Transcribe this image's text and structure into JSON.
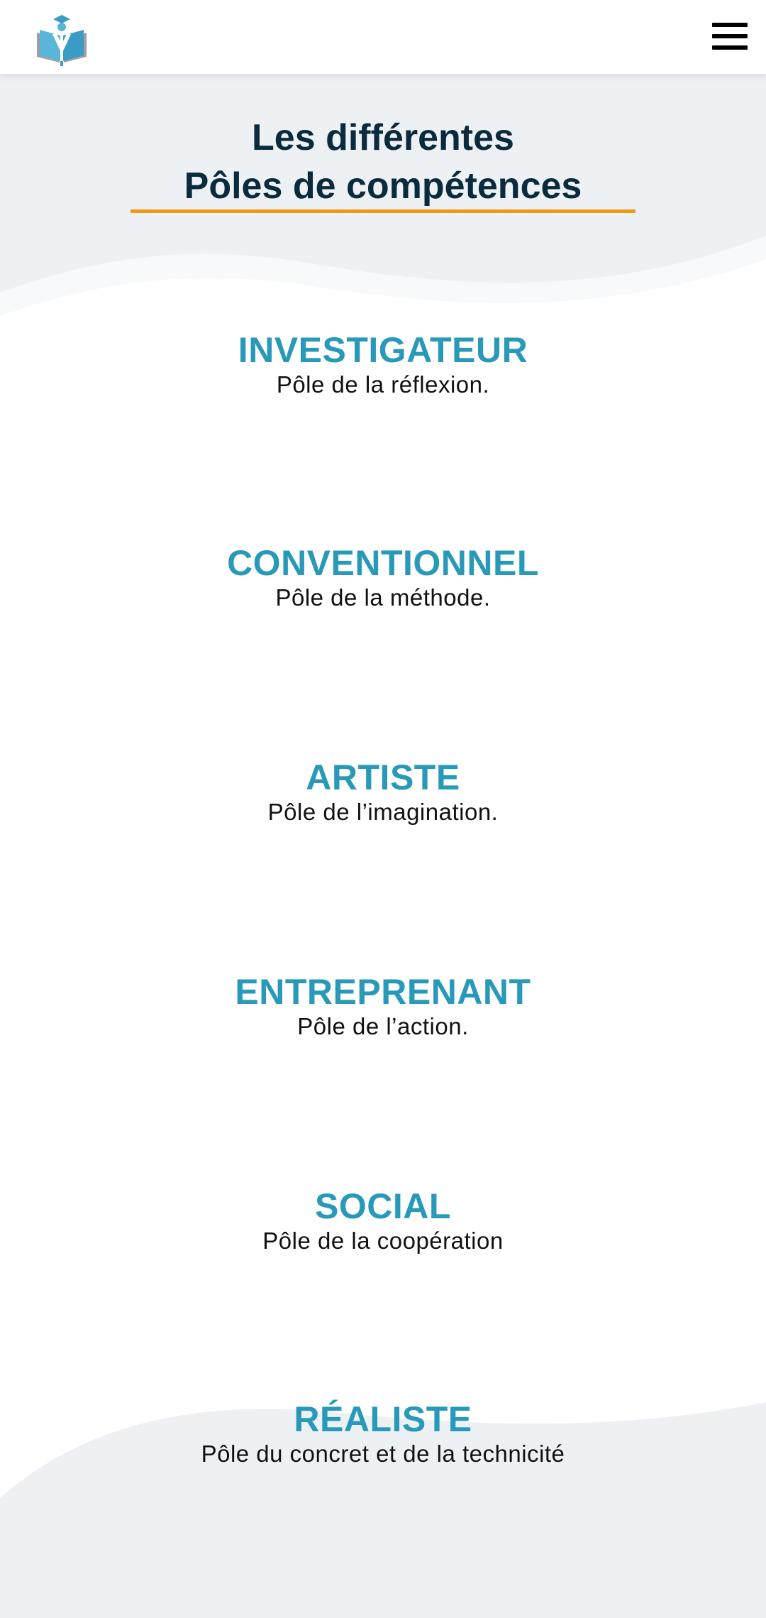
{
  "header": {
    "logo_icon": "graduate-book-logo-icon",
    "menu_icon": "hamburger-menu-icon"
  },
  "colors": {
    "title": "#0a2a3d",
    "accent_underline": "#f09a14",
    "pole_name": "#2899b8",
    "description": "#111111",
    "page_background": "#eef1f4"
  },
  "section": {
    "title_line1": "Les différentes",
    "title_line2": "Pôles de compétences"
  },
  "poles": [
    {
      "name": "INVESTIGATEUR",
      "description": "Pôle de la réflexion."
    },
    {
      "name": "CONVENTIONNEL",
      "description": "Pôle de la méthode."
    },
    {
      "name": "ARTISTE",
      "description": "Pôle de l’imagination."
    },
    {
      "name": "ENTREPRENANT",
      "description": "Pôle de l’action."
    },
    {
      "name": "SOCIAL",
      "description": "Pôle de la coopération"
    },
    {
      "name": "RÉALISTE",
      "description": "Pôle du concret et de la technicité"
    }
  ]
}
